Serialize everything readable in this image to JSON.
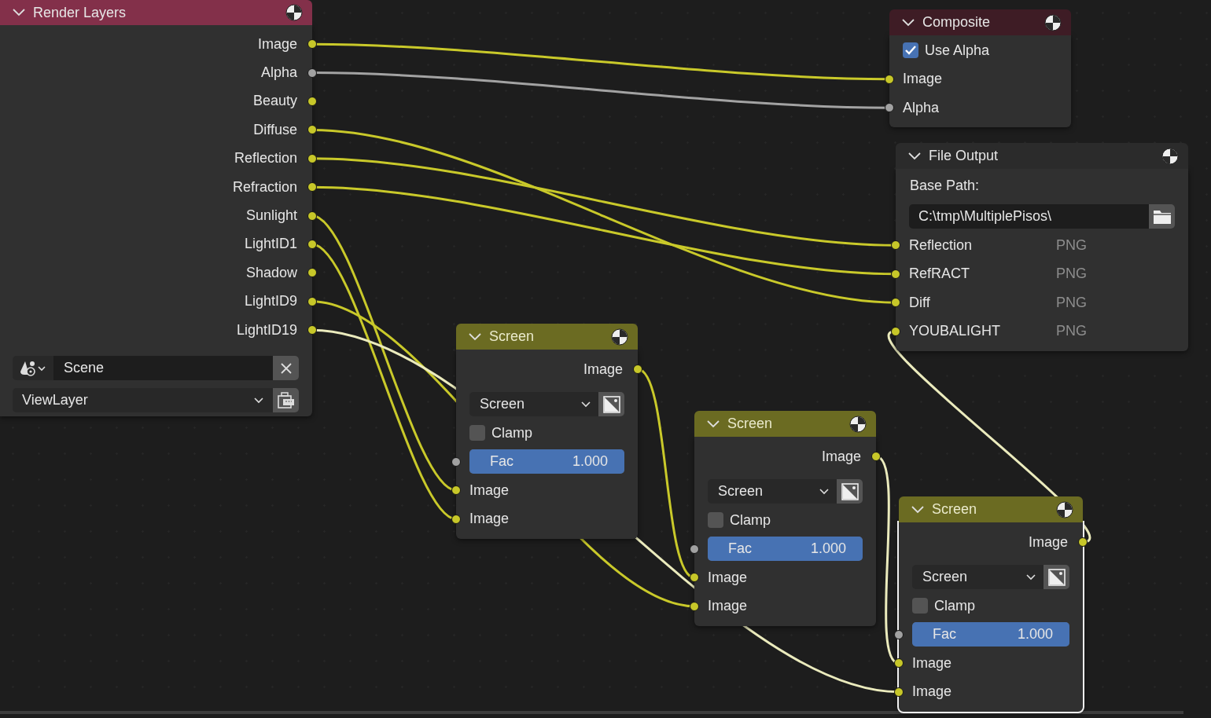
{
  "nodes": [
    {
      "kind": "render_layers",
      "title": "Render Layers",
      "selected": false,
      "outputs": [
        {
          "label": "Image",
          "kind": "color"
        },
        {
          "label": "Alpha",
          "kind": "value"
        },
        {
          "label": "Beauty",
          "kind": "color"
        },
        {
          "label": "Diffuse",
          "kind": "color"
        },
        {
          "label": "Reflection",
          "kind": "color"
        },
        {
          "label": "Refraction",
          "kind": "color"
        },
        {
          "label": "Sunlight",
          "kind": "color"
        },
        {
          "label": "LightID1",
          "kind": "color"
        },
        {
          "label": "Shadow",
          "kind": "color"
        },
        {
          "label": "LightID9",
          "kind": "color"
        },
        {
          "label": "LightID19",
          "kind": "color"
        }
      ],
      "scene": "Scene",
      "view_layer": "ViewLayer"
    },
    {
      "kind": "composite",
      "title": "Composite",
      "selected": false,
      "use_alpha": {
        "label": "Use Alpha",
        "checked": true
      },
      "inputs": [
        {
          "label": "Image",
          "kind": "color"
        },
        {
          "label": "Alpha",
          "kind": "value"
        }
      ]
    },
    {
      "kind": "file_output",
      "title": "File Output",
      "selected": false,
      "base_path_label": "Base Path:",
      "base_path": "C:\\tmp\\MultiplePisos\\",
      "inputs": [
        {
          "label": "Reflection",
          "format": "PNG",
          "kind": "color"
        },
        {
          "label": "RefRACT",
          "format": "PNG",
          "kind": "color"
        },
        {
          "label": "Diff",
          "format": "PNG",
          "kind": "color"
        },
        {
          "label": "YOUBALIGHT",
          "format": "PNG",
          "kind": "color"
        }
      ]
    },
    {
      "kind": "mix",
      "title": "Screen",
      "selected": false,
      "outputs": [
        {
          "label": "Image",
          "kind": "color"
        }
      ],
      "blend_mode": "Screen",
      "clamp": {
        "label": "Clamp",
        "checked": false
      },
      "inputs": [
        {
          "kind": "slider",
          "label": "Fac",
          "value": "1.000",
          "level": 1
        },
        {
          "kind": "color",
          "label": "Image"
        },
        {
          "kind": "color",
          "label": "Image"
        }
      ]
    },
    {
      "kind": "mix",
      "title": "Screen",
      "selected": false,
      "outputs": [
        {
          "label": "Image",
          "kind": "color"
        }
      ],
      "blend_mode": "Screen",
      "clamp": {
        "label": "Clamp",
        "checked": false
      },
      "inputs": [
        {
          "kind": "slider",
          "label": "Fac",
          "value": "1.000",
          "level": 1
        },
        {
          "kind": "color",
          "label": "Image"
        },
        {
          "kind": "color",
          "label": "Image"
        }
      ]
    },
    {
      "kind": "mix",
      "title": "Screen",
      "selected": true,
      "outputs": [
        {
          "label": "Image",
          "kind": "color"
        }
      ],
      "blend_mode": "Screen",
      "clamp": {
        "label": "Clamp",
        "checked": false
      },
      "inputs": [
        {
          "kind": "slider",
          "label": "Fac",
          "value": "1.000",
          "level": 1
        },
        {
          "kind": "color",
          "label": "Image"
        },
        {
          "kind": "color",
          "label": "Image"
        }
      ]
    }
  ]
}
